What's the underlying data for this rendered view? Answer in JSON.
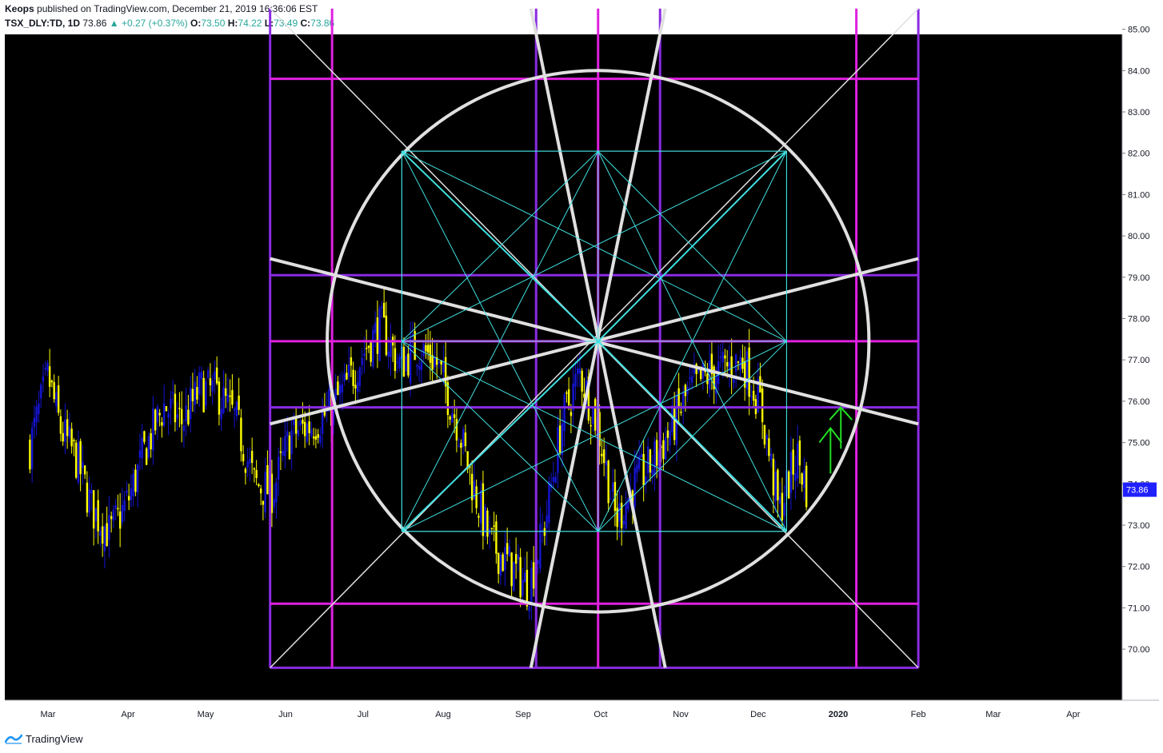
{
  "header": {
    "author": "Keops",
    "published_text": "published on TradingView.com, December 21, 2019 16:36:06 EST",
    "symbol": "TSX_DLY:TD, 1D",
    "last": "73.86",
    "change": "▲ +0.27 (+0.37%)",
    "o_label": "O:",
    "o": "73.50",
    "h_label": "H:",
    "h": "74.22",
    "l_label": "L:",
    "l": "73.49",
    "c_label": "C:",
    "c": "73.86"
  },
  "footer": {
    "brand": "TradingView"
  },
  "colors": {
    "background": "#000000",
    "bull": "#1414d2",
    "bear": "#ffff00",
    "frame_purple": "#8a2be2",
    "frame_magenta": "#e020e0",
    "circle": "#e0e0e0",
    "star": "#40e0e0",
    "arrow": "#22dd22",
    "price_tag": "#2020ff"
  },
  "chart_data": {
    "type": "candlestick",
    "symbol": "TSX_DLY:TD",
    "interval": "1D",
    "ylim": [
      69.4,
      85.3
    ],
    "y_ticks": [
      "70.00",
      "71.00",
      "72.00",
      "73.00",
      "74.00",
      "75.00",
      "76.00",
      "77.00",
      "78.00",
      "79.00",
      "80.00",
      "81.00",
      "82.00",
      "83.00",
      "84.00",
      "85.00"
    ],
    "x_ticks": [
      "Mar",
      "Apr",
      "May",
      "Jun",
      "Jul",
      "Aug",
      "Sep",
      "Oct",
      "Nov",
      "Dec",
      "2020",
      "Feb",
      "Mar",
      "Apr"
    ],
    "x_tick_dates": [
      "2019-03-01",
      "2019-04-01",
      "2019-05-01",
      "2019-06-01",
      "2019-07-01",
      "2019-08-01",
      "2019-09-01",
      "2019-10-01",
      "2019-11-01",
      "2019-12-01",
      "2020-01-01",
      "2020-02-01",
      "2020-03-01",
      "2020-04-01"
    ],
    "last_price_label": "73.86",
    "close_series": {
      "dates": [
        "2019-02-22",
        "2019-03-01",
        "2019-03-06",
        "2019-03-12",
        "2019-03-18",
        "2019-03-25",
        "2019-04-01",
        "2019-04-08",
        "2019-04-15",
        "2019-04-22",
        "2019-04-29",
        "2019-05-06",
        "2019-05-13",
        "2019-05-20",
        "2019-05-27",
        "2019-06-03",
        "2019-06-10",
        "2019-06-17",
        "2019-06-24",
        "2019-07-02",
        "2019-07-08",
        "2019-07-15",
        "2019-07-22",
        "2019-07-29",
        "2019-08-06",
        "2019-08-12",
        "2019-08-19",
        "2019-08-26",
        "2019-09-03",
        "2019-09-09",
        "2019-09-16",
        "2019-09-23",
        "2019-09-30",
        "2019-10-07",
        "2019-10-14",
        "2019-10-21",
        "2019-10-28",
        "2019-11-04",
        "2019-11-11",
        "2019-11-18",
        "2019-11-25",
        "2019-12-02",
        "2019-12-09",
        "2019-12-16",
        "2019-12-20"
      ],
      "close": [
        74.9,
        76.6,
        75.3,
        74.6,
        73.4,
        72.8,
        73.6,
        74.9,
        75.9,
        75.5,
        76.3,
        76.2,
        75.5,
        74.0,
        73.8,
        75.2,
        75.4,
        75.7,
        76.3,
        77.3,
        77.8,
        76.9,
        77.3,
        77.0,
        75.6,
        74.1,
        72.6,
        72.1,
        71.5,
        72.9,
        75.5,
        76.7,
        75.4,
        73.1,
        74.0,
        74.5,
        75.3,
        76.2,
        76.6,
        76.8,
        77.0,
        75.9,
        73.3,
        74.7,
        73.86
      ]
    }
  }
}
